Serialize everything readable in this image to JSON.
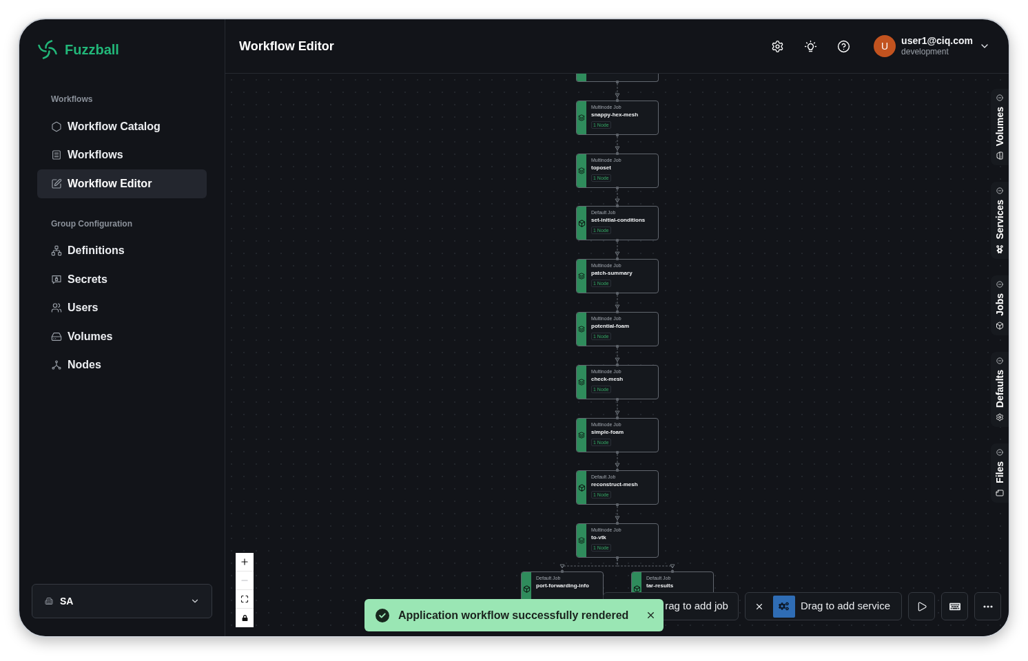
{
  "sidebar": {
    "brand": "Fuzzball",
    "sections": [
      {
        "heading": "Workflows",
        "items": [
          {
            "label": "Workflow Catalog",
            "selected": false
          },
          {
            "label": "Workflows",
            "selected": false
          },
          {
            "label": "Workflow Editor",
            "selected": true
          }
        ]
      },
      {
        "heading": "Group Configuration",
        "items": [
          {
            "label": "Definitions",
            "selected": false
          },
          {
            "label": "Secrets",
            "selected": false
          },
          {
            "label": "Users",
            "selected": false
          },
          {
            "label": "Volumes",
            "selected": false
          },
          {
            "label": "Nodes",
            "selected": false
          }
        ]
      }
    ],
    "account_selector": {
      "value": "SA"
    }
  },
  "header": {
    "title": "Workflow Editor",
    "user": {
      "initial": "U",
      "email": "user1@ciq.com",
      "environment": "development"
    }
  },
  "canvas": {
    "chain": [
      {
        "kind": "partial"
      },
      {
        "kind": "multinode",
        "type_label": "Multinode Job",
        "name": "snappy-hex-mesh",
        "badge": "1 Node"
      },
      {
        "kind": "multinode",
        "type_label": "Multinode Job",
        "name": "toposet",
        "badge": "1 Node"
      },
      {
        "kind": "default",
        "type_label": "Default Job",
        "name": "set-initial-conditions",
        "badge": "1 Node"
      },
      {
        "kind": "multinode",
        "type_label": "Multinode Job",
        "name": "patch-summary",
        "badge": "1 Node"
      },
      {
        "kind": "multinode",
        "type_label": "Multinode Job",
        "name": "potential-foam",
        "badge": "1 Node"
      },
      {
        "kind": "multinode",
        "type_label": "Multinode Job",
        "name": "check-mesh",
        "badge": "1 Node"
      },
      {
        "kind": "multinode",
        "type_label": "Multinode Job",
        "name": "simple-foam",
        "badge": "1 Node"
      },
      {
        "kind": "default",
        "type_label": "Default Job",
        "name": "reconstruct-mesh",
        "badge": "1 Node"
      },
      {
        "kind": "multinode",
        "type_label": "Multinode Job",
        "name": "to-vtk",
        "badge": "1 Node"
      }
    ],
    "branches": [
      {
        "kind": "default",
        "type_label": "Default Job",
        "name": "port-forwarding-info"
      },
      {
        "kind": "default",
        "type_label": "Default Job",
        "name": "tar-results"
      }
    ],
    "side_tabs": [
      {
        "label": "Volumes"
      },
      {
        "label": "Services"
      },
      {
        "label": "Jobs"
      },
      {
        "label": "Defaults"
      },
      {
        "label": "Files"
      }
    ],
    "zoom_controls": [
      {
        "kind": "zoom_in",
        "disabled": false
      },
      {
        "kind": "zoom_out",
        "disabled": true
      },
      {
        "kind": "fit_view",
        "disabled": false
      },
      {
        "kind": "lock",
        "disabled": false
      }
    ],
    "toolbar": {
      "job_button": {
        "label": "rag to add job"
      },
      "service_button": {
        "label": "Drag to add service"
      }
    },
    "toast": {
      "message": "Application workflow successfully rendered"
    }
  }
}
